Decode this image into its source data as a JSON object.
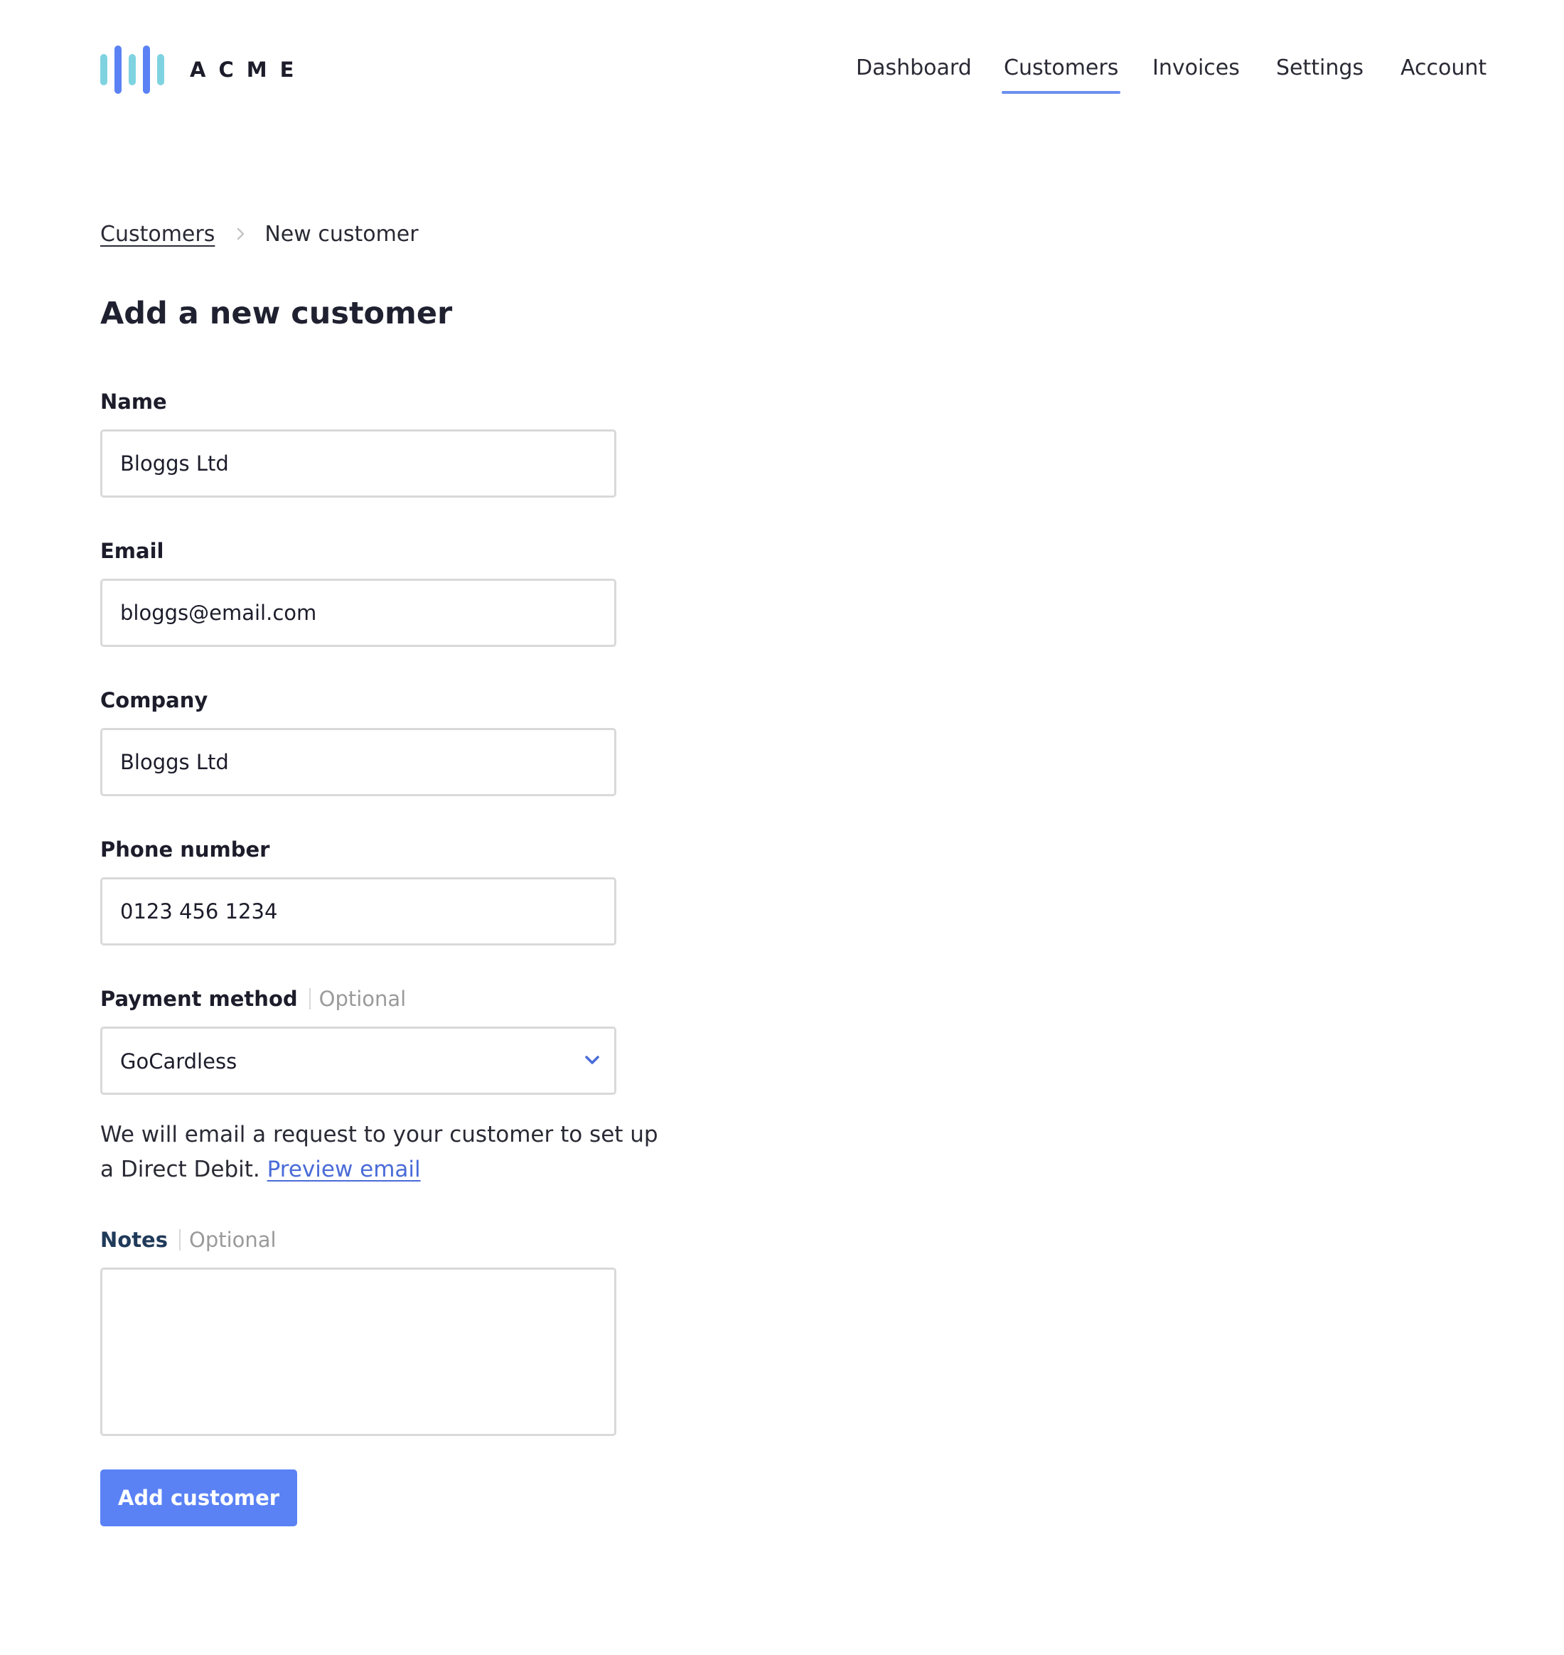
{
  "brand": {
    "name": "ACME",
    "logo_colors": [
      "#7fd3e0",
      "#5a82f5"
    ]
  },
  "nav": {
    "items": [
      {
        "label": "Dashboard"
      },
      {
        "label": "Customers",
        "active": true
      },
      {
        "label": "Invoices"
      },
      {
        "label": "Settings"
      },
      {
        "label": "Account"
      }
    ]
  },
  "breadcrumb": {
    "parent": "Customers",
    "current": "New customer",
    "separator_icon": "chevron-right-icon"
  },
  "page": {
    "title": "Add a new customer"
  },
  "form": {
    "name": {
      "label": "Name",
      "value": "Bloggs Ltd"
    },
    "email": {
      "label": "Email",
      "value": "bloggs@email.com"
    },
    "company": {
      "label": "Company",
      "value": "Bloggs Ltd"
    },
    "phone": {
      "label": "Phone number",
      "value": "0123 456 1234"
    },
    "payment_method": {
      "label": "Payment method",
      "optional_tag": "Optional",
      "selected": "GoCardless",
      "dropdown_icon": "chevron-down-icon"
    },
    "helper": {
      "text": "We will email a request to your customer to set up a Direct Debit.",
      "link": "Preview email"
    },
    "notes": {
      "label": "Notes",
      "optional_tag": "Optional",
      "value": ""
    },
    "submit_label": "Add customer"
  },
  "colors": {
    "accent": "#5a82f5",
    "link": "#4a6bd8",
    "nav_underline": "#6b8ff0",
    "border": "#d9d9d9",
    "muted": "#9a9a9a"
  }
}
